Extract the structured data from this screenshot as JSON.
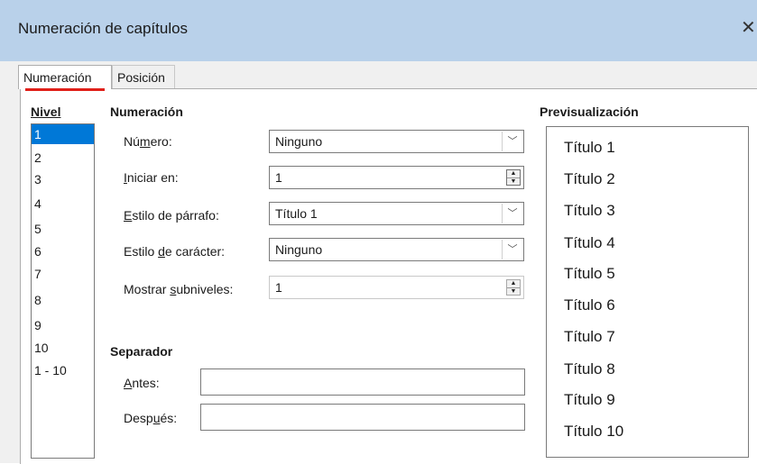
{
  "window": {
    "title": "Numeración de capítulos",
    "close_label": "✕"
  },
  "tabs": [
    {
      "label": "Numeración",
      "active": true
    },
    {
      "label": "Posición",
      "active": false
    }
  ],
  "levels": {
    "header": "Nivel",
    "items": [
      "1",
      "2",
      "3",
      "4",
      "5",
      "6",
      "7",
      "8",
      "9",
      "10",
      "1 - 10"
    ],
    "selected": "1"
  },
  "numbering": {
    "heading": "Numeración",
    "number": {
      "label_pre": "Nú",
      "label_u": "m",
      "label_post": "ero:",
      "value": "Ninguno"
    },
    "start_at": {
      "label_pre": "",
      "label_u": "I",
      "label_post": "niciar en:",
      "value": "1"
    },
    "para_style": {
      "label_pre": "",
      "label_u": "E",
      "label_post": "stilo de párrafo:",
      "value": "Título 1"
    },
    "char_style": {
      "label_pre": "Estilo ",
      "label_u": "d",
      "label_post": "e carácter:",
      "value": "Ninguno"
    },
    "sublevels": {
      "label_pre": "Mostrar ",
      "label_u": "s",
      "label_post": "ubniveles:",
      "value": "1"
    }
  },
  "separator": {
    "heading": "Separador",
    "before": {
      "label_pre": "",
      "label_u": "A",
      "label_post": "ntes:",
      "value": ""
    },
    "after": {
      "label_pre": "Desp",
      "label_u": "u",
      "label_post": "és:",
      "value": ""
    }
  },
  "preview": {
    "heading": "Previsualización",
    "lines": [
      "Título 1",
      "Título 2",
      "Título 3",
      "Título 4",
      "Título 5",
      "Título 6",
      "Título 7",
      "Título 8",
      "Título 9",
      "Título 10"
    ]
  },
  "icons": {
    "dropdown": "chevron-down-icon",
    "spin_up": "▲",
    "spin_down": "▼",
    "combo_arrow": "﹀"
  },
  "colors": {
    "titlebar": "#b9d1ea",
    "selection": "#0078d7",
    "tab_indicator": "#e0201a"
  }
}
